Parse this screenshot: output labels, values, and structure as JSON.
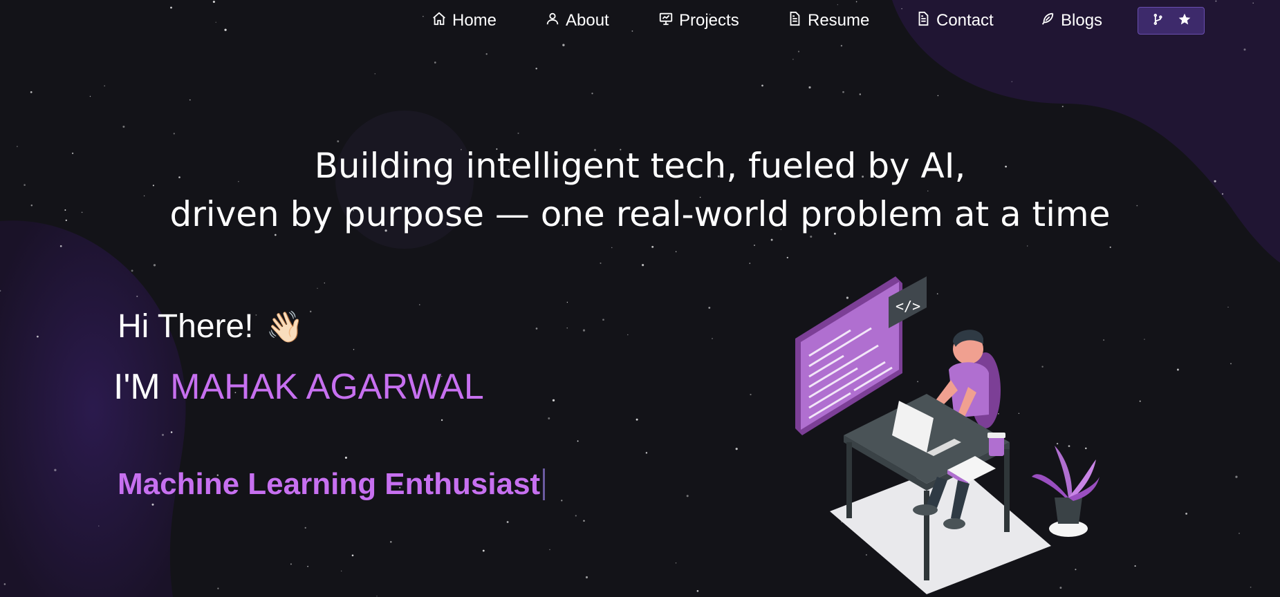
{
  "nav": {
    "items": [
      {
        "label": "Home",
        "icon": "home-icon"
      },
      {
        "label": "About",
        "icon": "user-icon"
      },
      {
        "label": "Projects",
        "icon": "projects-icon"
      },
      {
        "label": "Resume",
        "icon": "document-icon"
      },
      {
        "label": "Contact",
        "icon": "document-icon"
      },
      {
        "label": "Blogs",
        "icon": "feather-icon"
      }
    ],
    "github_button": {
      "icons": [
        "fork-icon",
        "star-icon"
      ]
    }
  },
  "hero": {
    "tagline_line1": "Building intelligent tech, fueled by AI,",
    "tagline_line2": "driven by purpose — one real-world problem at a time",
    "greeting": "Hi There!",
    "greeting_emoji": "👋🏻",
    "name_prefix": "I'M",
    "name": "MAHAK AGARWAL",
    "role": "Machine Learning Enthusiast"
  },
  "colors": {
    "background": "#131318",
    "accent": "#c770f0",
    "button_bg": "#3d2a6b",
    "blob": "#2a1a4a"
  }
}
